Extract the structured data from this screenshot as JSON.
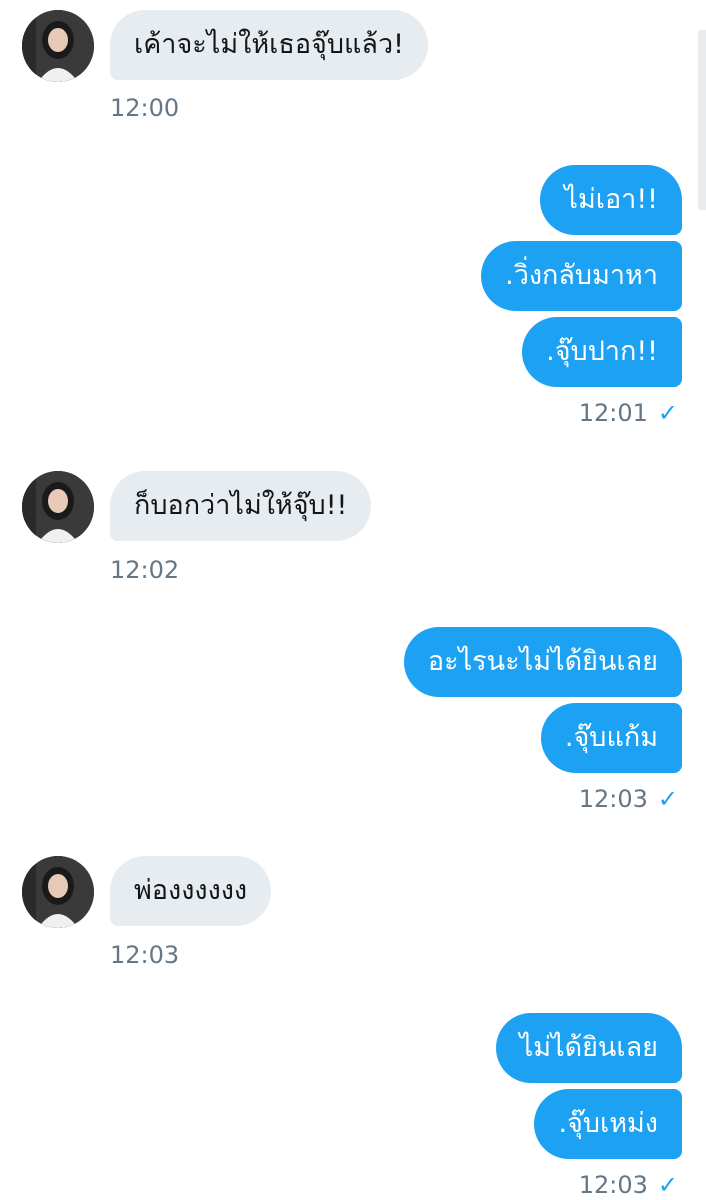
{
  "conversation": {
    "groups": [
      {
        "direction": "in",
        "messages": [
          "เค้าจะไม่ให้เธอจุ๊บแล้ว!"
        ],
        "time": "12:00"
      },
      {
        "direction": "out",
        "messages": [
          "ไม่เอา!!",
          ".วิ่งกลับมาหา",
          ".จุ๊บปาก!!"
        ],
        "time": "12:01"
      },
      {
        "direction": "in",
        "messages": [
          "ก็บอกว่าไม่ให้จุ๊บ!!"
        ],
        "time": "12:02"
      },
      {
        "direction": "out",
        "messages": [
          "อะไรนะไม่ได้ยินเลย",
          ".จุ๊บแก้ม"
        ],
        "time": "12:03"
      },
      {
        "direction": "in",
        "messages": [
          "พ่องงงงงง"
        ],
        "time": "12:03"
      },
      {
        "direction": "out",
        "messages": [
          "ไม่ได้ยินเลย",
          ".จุ๊บเหม่ง"
        ],
        "time": "12:03"
      }
    ],
    "read_receipt_icon": "check-icon",
    "colors": {
      "outgoing_bubble": "#1da1f2",
      "incoming_bubble": "#e6ecf0",
      "timestamp": "#657786"
    }
  }
}
